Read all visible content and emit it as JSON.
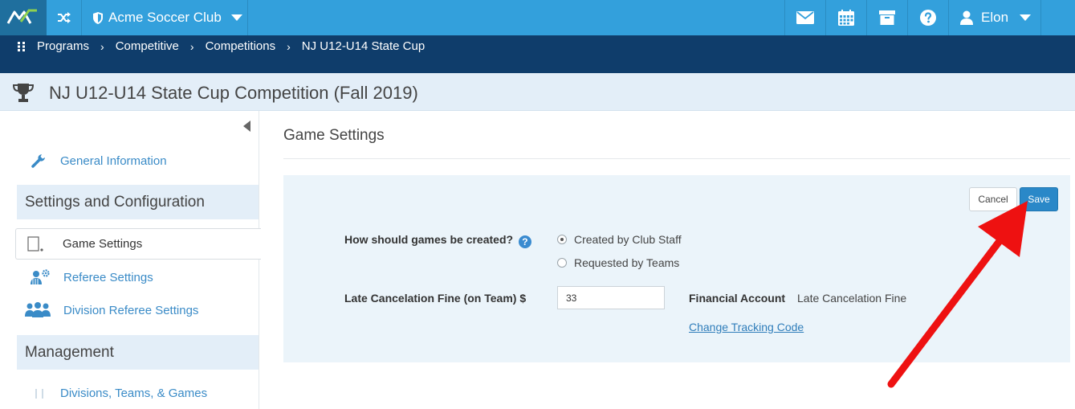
{
  "topnav": {
    "club_name": "Acme Soccer Club",
    "user_name": "Elon",
    "bg_color": "#33a0dc"
  },
  "breadcrumb": {
    "items": [
      "Programs",
      "Competitive",
      "Competitions",
      "NJ U12-U14 State Cup"
    ],
    "sep": "›"
  },
  "page": {
    "title": "NJ U12-U14 State Cup Competition (Fall 2019)"
  },
  "sidebar": {
    "general_information": "General Information",
    "section_settings": "Settings and Configuration",
    "game_settings": "Game Settings",
    "referee_settings": "Referee Settings",
    "division_referee_settings": "Division Referee Settings",
    "section_management": "Management",
    "divisions_teams_games": "Divisions, Teams, & Games"
  },
  "main": {
    "heading": "Game Settings",
    "cancel_label": "Cancel",
    "save_label": "Save",
    "games_created_label": "How should games be created?",
    "help_glyph": "?",
    "radio_options": [
      {
        "label": "Created by Club Staff",
        "selected": true
      },
      {
        "label": "Requested by Teams",
        "selected": false
      }
    ],
    "late_fine_label": "Late Cancelation Fine (on Team) $",
    "late_fine_value": "33",
    "financial_account_label": "Financial Account",
    "financial_account_value": "Late Cancelation Fine",
    "change_tracking_code": "Change Tracking Code"
  },
  "annotation": {
    "arrow_color": "#ee1111"
  }
}
